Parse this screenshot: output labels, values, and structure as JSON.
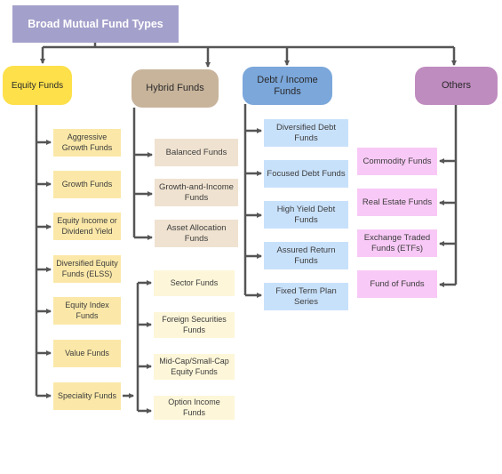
{
  "title": "Broad Mutual Fund Types",
  "colors": {
    "root": "#a3a0cb",
    "equity": "#fde04a",
    "hybrid": "#c8b49b",
    "debt": "#7ba7db",
    "others": "#bf8cbf",
    "connector": "#555555"
  },
  "categories": {
    "equity": {
      "label": "Equity Funds",
      "children": [
        "Aggressive Growth Funds",
        "Growth Funds",
        "Equity Income or Dividend Yield",
        "Diversified Equity Funds (ELSS)",
        "Equity Index Funds",
        "Value Funds",
        "Speciality Funds"
      ]
    },
    "hybrid": {
      "label": "Hybrid Funds",
      "children": [
        "Balanced Funds",
        "Growth-and-Income Funds",
        "Asset Allocation Funds"
      ]
    },
    "debt": {
      "label": "Debt / Income Funds",
      "children": [
        "Diversified Debt Funds",
        "Focused Debt Funds",
        "High Yield Debt Funds",
        "Assured Return Funds",
        "Fixed Term Plan Series"
      ]
    },
    "others": {
      "label": "Others",
      "children": [
        "Commodity Funds",
        "Real Estate Funds",
        "Exchange Traded Funds (ETFs)",
        "Fund of Funds"
      ]
    }
  },
  "speciality": {
    "parent": "Speciality Funds",
    "children": [
      "Sector Funds",
      "Foreign Securities Funds",
      "Mid-Cap/Small-Cap Equity Funds",
      "Option Income Funds"
    ]
  }
}
